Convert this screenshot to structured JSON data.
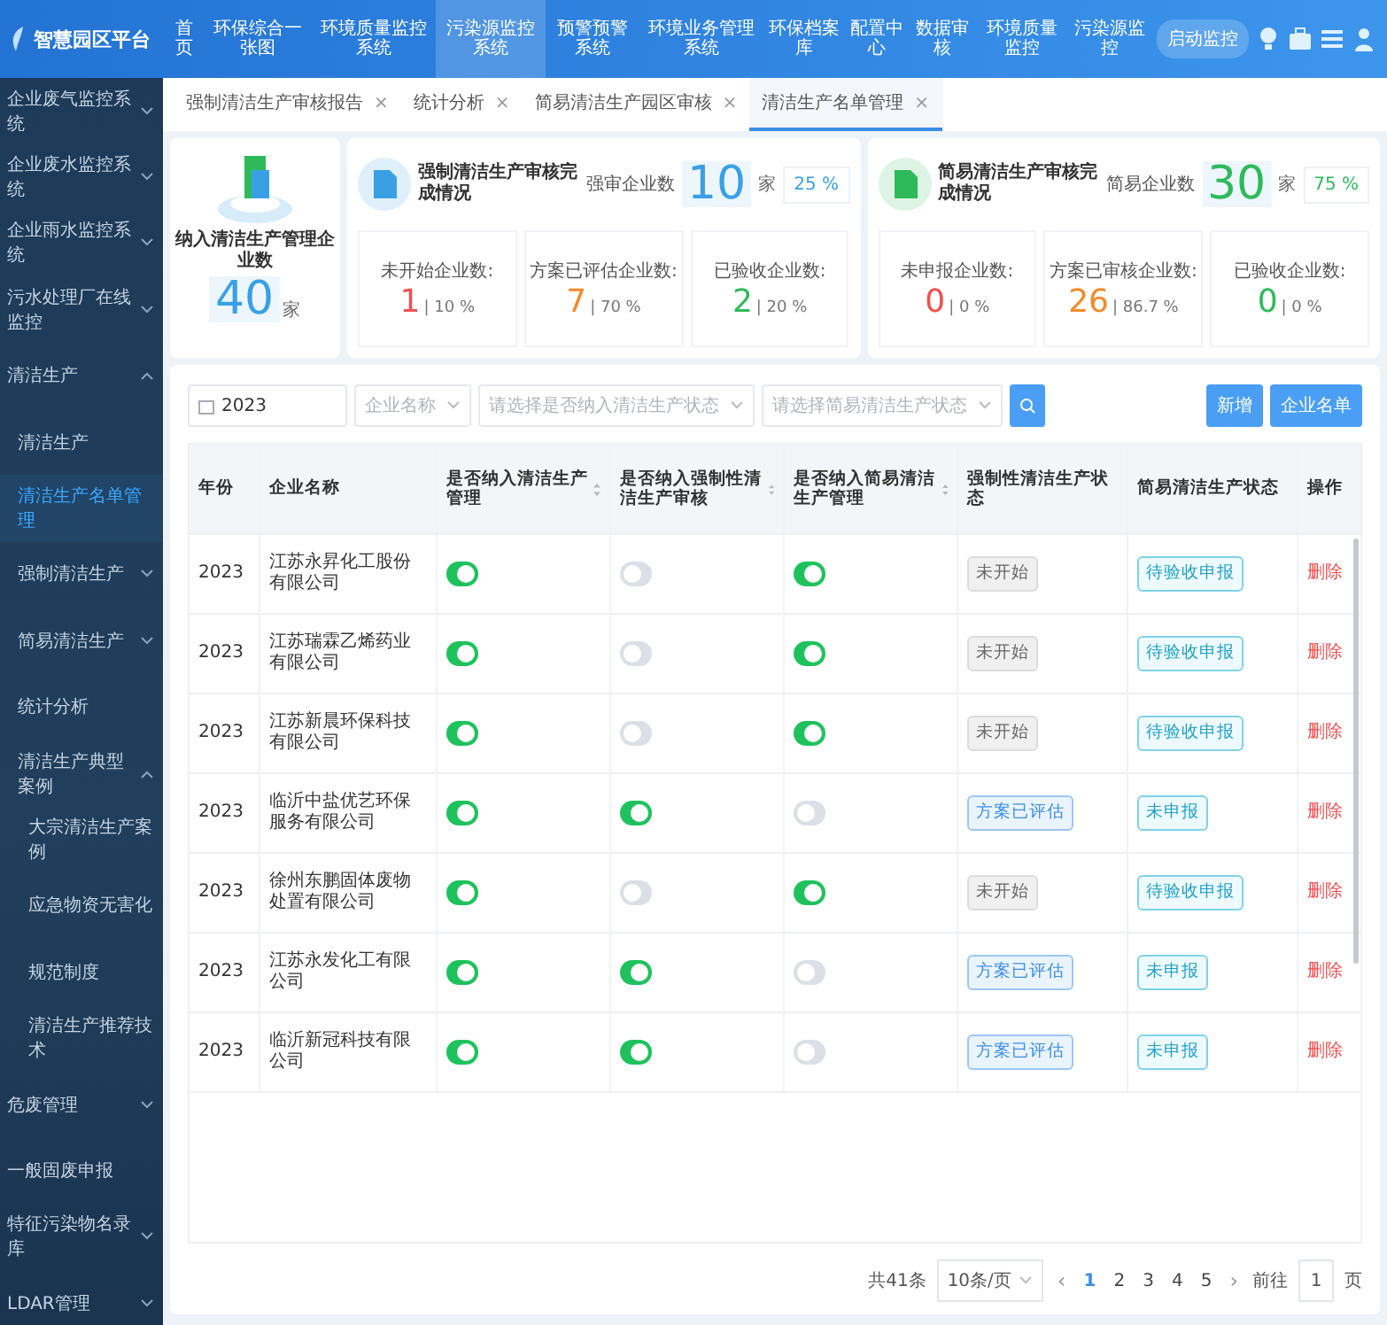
{
  "header": {
    "logo": "智慧园区平台",
    "action_button": "启动监控",
    "nav": [
      {
        "label": "首页",
        "selected": false
      },
      {
        "label": "环保综合一张图",
        "selected": false
      },
      {
        "label": "环境质量监控系统",
        "selected": false
      },
      {
        "label": "污染源监控系统",
        "selected": true
      },
      {
        "label": "预警预警系统",
        "selected": false
      },
      {
        "label": "环境业务管理系统",
        "selected": false
      },
      {
        "label": "环保档案库",
        "selected": false
      },
      {
        "label": "配置中心",
        "selected": false
      },
      {
        "label": "数据审核",
        "selected": false
      },
      {
        "label": "环境质量监控",
        "selected": false
      },
      {
        "label": "污染源监控",
        "selected": false
      }
    ]
  },
  "sidebar": {
    "items": [
      {
        "label": "企业废气监控系统",
        "selected": false,
        "expanded": false
      },
      {
        "label": "企业废水监控系统",
        "selected": false,
        "expanded": false
      },
      {
        "label": "企业雨水监控系统",
        "selected": false,
        "expanded": false
      },
      {
        "label": "污水处理厂在线监控",
        "selected": false,
        "expanded": false
      },
      {
        "label": "清洁生产",
        "selected": false,
        "expanded": true,
        "children": [
          {
            "label": "清洁生产",
            "selected": false
          },
          {
            "label": "清洁生产名单管理",
            "selected": true
          },
          {
            "label": "强制清洁生产",
            "selected": false,
            "expanded": false
          },
          {
            "label": "简易清洁生产",
            "selected": false,
            "expanded": false
          },
          {
            "label": "统计分析",
            "selected": false
          },
          {
            "label": "清洁生产典型案例",
            "selected": false,
            "expanded": true,
            "children": [
              {
                "label": "大宗清洁生产案例",
                "selected": false
              },
              {
                "label": "应急物资无害化",
                "selected": false
              },
              {
                "label": "规范制度",
                "selected": false
              },
              {
                "label": "清洁生产推荐技术",
                "selected": false
              }
            ]
          }
        ]
      },
      {
        "label": "危废管理",
        "selected": false,
        "expanded": false
      },
      {
        "label": "一般固废申报",
        "selected": false
      },
      {
        "label": "特征污染物名录库",
        "selected": false,
        "expanded": false
      },
      {
        "label": "LDAR管理",
        "selected": false,
        "expanded": false
      }
    ]
  },
  "tabs": [
    {
      "label": "强制清洁生产审核报告",
      "selected": false,
      "close": "×"
    },
    {
      "label": "统计分析",
      "selected": false,
      "close": "×"
    },
    {
      "label": "简易清洁生产园区审核",
      "selected": false,
      "close": "×"
    },
    {
      "label": "清洁生产名单管理",
      "selected": true,
      "close": "×"
    }
  ],
  "summary": {
    "total": {
      "title": "纳入清洁生产管理企业数",
      "value": "40",
      "unit": "家"
    },
    "panels": [
      {
        "kind": "blue",
        "title": "强制清洁生产审核完成情况",
        "count_label": "强审企业数",
        "count": "10",
        "unit": "家",
        "percent": "25 %",
        "stats": [
          {
            "label": "未开始企业数:",
            "value": "1",
            "percent": "| 10 %",
            "color": "#f0504f"
          },
          {
            "label": "方案已评估企业数:",
            "value": "7",
            "percent": "| 70 %",
            "color": "#f5892b"
          },
          {
            "label": "已验收企业数:",
            "value": "2",
            "percent": "| 20 %",
            "color": "#2fba5a"
          }
        ]
      },
      {
        "kind": "green",
        "title": "简易清洁生产审核完成情况",
        "count_label": "简易企业数",
        "count": "30",
        "unit": "家",
        "percent": "75 %",
        "stats": [
          {
            "label": "未申报企业数:",
            "value": "0",
            "percent": "| 0 %",
            "color": "#f0504f"
          },
          {
            "label": "方案已审核企业数:",
            "value": "26",
            "percent": "| 86.7 %",
            "color": "#f5892b"
          },
          {
            "label": "已验收企业数:",
            "value": "0",
            "percent": "| 0 %",
            "color": "#2fba5a"
          }
        ]
      }
    ]
  },
  "filters": {
    "year": "2023",
    "selects": [
      {
        "placeholder": "企业名称"
      },
      {
        "placeholder": "请选择是否纳入清洁生产状态"
      },
      {
        "placeholder": "请选择简易清洁生产状态"
      }
    ],
    "buttons": [
      "新增",
      "企业名单"
    ]
  },
  "table": {
    "columns": [
      {
        "label": "年份",
        "sortable": false
      },
      {
        "label": "企业名称",
        "sortable": false
      },
      {
        "label": "是否纳入清洁生产管理",
        "sortable": true
      },
      {
        "label": "是否纳入强制性清洁生产审核",
        "sortable": true
      },
      {
        "label": "是否纳入简易清洁生产管理",
        "sortable": true
      },
      {
        "label": "强制性清洁生产状态",
        "sortable": false
      },
      {
        "label": "简易清洁生产状态",
        "sortable": false
      },
      {
        "label": "操作",
        "sortable": false
      }
    ],
    "rows": [
      {
        "year": "2023",
        "company": "江苏永昇化工股份有限公司",
        "managed": true,
        "mandatory": false,
        "simple": true,
        "mandatory_status": {
          "label": "未开始",
          "kind": "not_started"
        },
        "simple_status": "待验收申报",
        "action": "删除"
      },
      {
        "year": "2023",
        "company": "江苏瑞霖乙烯药业有限公司",
        "managed": true,
        "mandatory": false,
        "simple": true,
        "mandatory_status": {
          "label": "未开始",
          "kind": "not_started"
        },
        "simple_status": "待验收申报",
        "action": "删除"
      },
      {
        "year": "2023",
        "company": "江苏新晨环保科技有限公司",
        "managed": true,
        "mandatory": false,
        "simple": true,
        "mandatory_status": {
          "label": "未开始",
          "kind": "not_started"
        },
        "simple_status": "待验收申报",
        "action": "删除"
      },
      {
        "year": "2023",
        "company": "临沂中盐优艺环保服务有限公司",
        "managed": true,
        "mandatory": true,
        "simple": false,
        "mandatory_status": {
          "label": "方案已评估",
          "kind": "assessed"
        },
        "simple_status": "未申报",
        "action": "删除"
      },
      {
        "year": "2023",
        "company": "徐州东鹏固体废物处置有限公司",
        "managed": true,
        "mandatory": false,
        "simple": true,
        "mandatory_status": {
          "label": "未开始",
          "kind": "not_started"
        },
        "simple_status": "待验收申报",
        "action": "删除"
      },
      {
        "year": "2023",
        "company": "江苏永发化工有限公司",
        "managed": true,
        "mandatory": true,
        "simple": false,
        "mandatory_status": {
          "label": "方案已评估",
          "kind": "assessed"
        },
        "simple_status": "未申报",
        "action": "删除"
      },
      {
        "year": "2023",
        "company": "临沂新冠科技有限公司",
        "managed": true,
        "mandatory": true,
        "simple": false,
        "mandatory_status": {
          "label": "方案已评估",
          "kind": "assessed"
        },
        "simple_status": "未申报",
        "action": "删除"
      }
    ]
  },
  "pagination": {
    "total": "共41条",
    "page_size": "10条/页",
    "prev": "‹",
    "next": "›",
    "pages": [
      {
        "label": "1",
        "selected": true
      },
      {
        "label": "2",
        "selected": false
      },
      {
        "label": "3",
        "selected": false
      },
      {
        "label": "4",
        "selected": false
      },
      {
        "label": "5",
        "selected": false
      }
    ],
    "goto_label": "前往",
    "goto_value": "1",
    "goto_suffix": "页"
  }
}
